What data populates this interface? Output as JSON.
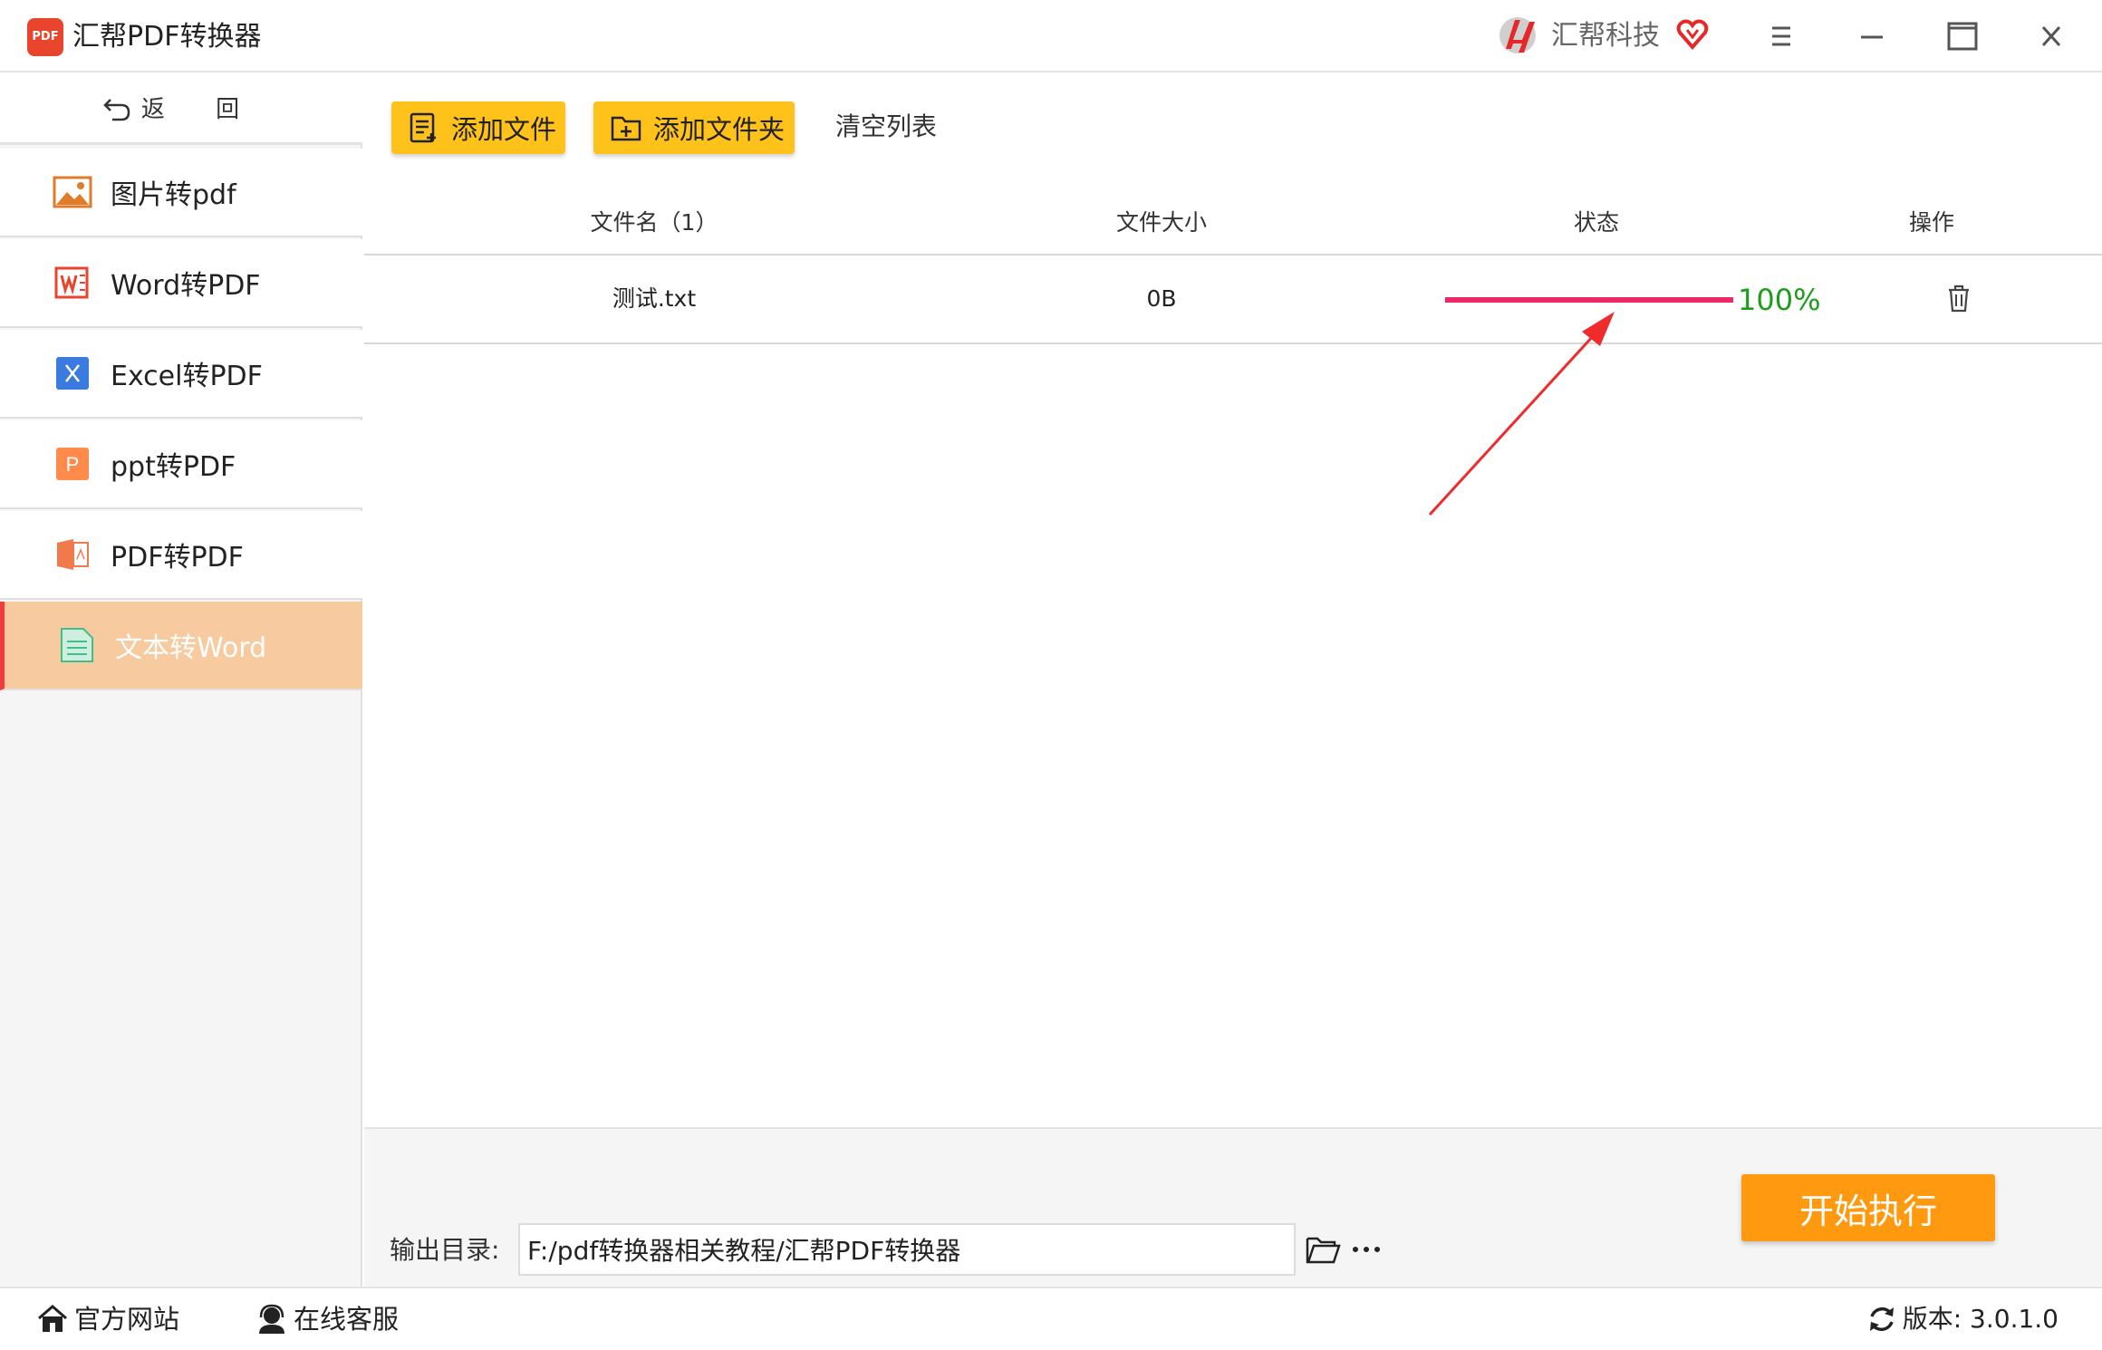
{
  "app": {
    "logo_text": "PDF",
    "title": "汇帮PDF转换器",
    "brand": "汇帮科技"
  },
  "window_controls": [
    "menu-icon",
    "minimize-icon",
    "maximize-icon",
    "close-icon"
  ],
  "sidebar": {
    "back_label": "返 回",
    "items": [
      {
        "label": "图片转pdf",
        "icon": "image-icon"
      },
      {
        "label": "Word转PDF",
        "icon": "word-icon"
      },
      {
        "label": "Excel转PDF",
        "icon": "excel-icon"
      },
      {
        "label": "ppt转PDF",
        "icon": "ppt-icon"
      },
      {
        "label": "PDF转PDF",
        "icon": "pdf-icon"
      },
      {
        "label": "文本转Word",
        "icon": "text-file-icon",
        "active": true
      }
    ]
  },
  "toolbar": {
    "add_file": "添加文件",
    "add_folder": "添加文件夹",
    "clear_list": "清空列表"
  },
  "table": {
    "headers": {
      "filename": "文件名（1）",
      "size": "文件大小",
      "status": "状态",
      "action": "操作"
    },
    "rows": [
      {
        "filename": "测试.txt",
        "size": "0B",
        "progress": 100,
        "progress_text": "100%"
      }
    ]
  },
  "output": {
    "label": "输出目录:",
    "path": "F:/pdf转换器相关教程/汇帮PDF转换器"
  },
  "start_button": "开始执行",
  "statusbar": {
    "website": "官方网站",
    "support": "在线客服",
    "version": "版本: 3.0.1.0"
  },
  "colors": {
    "accent_yellow": "#ffc21a",
    "start_orange": "#ff9a10",
    "active_nav": "#f7caa0",
    "progress": "#ee2865",
    "progress_text": "#1c9e1c"
  }
}
